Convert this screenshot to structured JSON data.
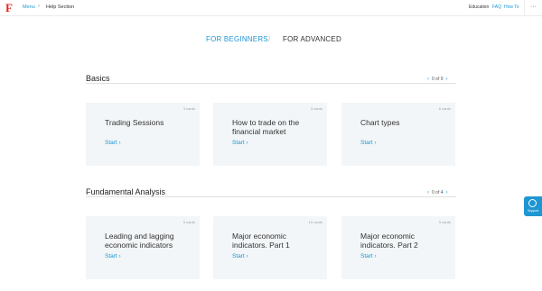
{
  "header": {
    "logo": "F",
    "breadcrumb": {
      "menu": "Menu",
      "separator": "›",
      "current": "Help Section"
    },
    "links": [
      "Education",
      "FAQ",
      "How To"
    ],
    "more": "···"
  },
  "level_tabs": {
    "beginners": "FOR BEGINNERS",
    "separator": "/",
    "advanced": "FOR ADVANCED"
  },
  "sections": [
    {
      "title": "Basics",
      "pager": {
        "prev": "‹",
        "text": "0 of 9",
        "next": "›"
      },
      "cards": [
        {
          "count": "3 cards",
          "title": "Trading Sessions",
          "start": "Start ›"
        },
        {
          "count": "3 cards",
          "title": "How to trade on the financial market",
          "start": "Start ›"
        },
        {
          "count": "6 cards",
          "title": "Chart types",
          "start": "Start ›"
        }
      ]
    },
    {
      "title": "Fundamental Analysis",
      "pager": {
        "prev": "‹",
        "text": "0 of 4",
        "next": "›"
      },
      "cards": [
        {
          "count": "5 cards",
          "title": "Leading and lagging economic indicators",
          "start": "Start ›"
        },
        {
          "count": "10 cards",
          "title": "Major economic indicators. Part 1",
          "start": "Start ›"
        },
        {
          "count": "5 cards",
          "title": "Major economic indicators. Part 2",
          "start": "Start ›"
        }
      ]
    }
  ],
  "support": {
    "label": "Support"
  },
  "colors": {
    "accent": "#1e96d2",
    "brand": "#e2261c",
    "card_bg": "#f3f6f8"
  }
}
